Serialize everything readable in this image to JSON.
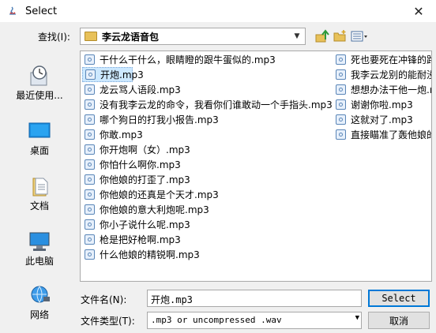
{
  "window": {
    "title": "Select"
  },
  "lookin": {
    "label": "查找(I):",
    "value": "李云龙语音包"
  },
  "places": [
    {
      "label": "最近使用...",
      "icon": "recent-icon"
    },
    {
      "label": "桌面",
      "icon": "desktop-icon"
    },
    {
      "label": "文档",
      "icon": "documents-icon"
    },
    {
      "label": "此电脑",
      "icon": "computer-icon"
    },
    {
      "label": "网络",
      "icon": "network-icon"
    }
  ],
  "files": {
    "col1": [
      "干什么干什么，眼睛瞪的跟牛蛋似的.mp3",
      "开炮.mp3",
      "龙云骂人语段.mp3",
      "没有我李云龙的命令，我看你们谁敢动一个手指头.mp3",
      "哪个狗日的打我小报告.mp3",
      "你敢.mp3",
      "你开炮啊（女）.mp3",
      "你怕什么啊你.mp3",
      "你他娘的打歪了.mp3",
      "你他娘的还真是个天才.mp3",
      "你他娘的意大利炮呢.mp3",
      "你小子说什么呢.mp3",
      "枪是把好枪啊.mp3",
      "什么他娘的精锐啊.mp3"
    ],
    "col2": [
      "死也要死在冲锋的路",
      "我李云龙别的能耐没",
      "想想办法干他一炮.m",
      "谢谢你啦.mp3",
      "这就对了.mp3",
      "直接瞄准了轰他娘的"
    ],
    "selected": "开炮.mp3"
  },
  "filename": {
    "label": "文件名(N):",
    "value": "开炮.mp3"
  },
  "filetype": {
    "label": "文件类型(T):",
    "value": ".mp3 or uncompressed .wav"
  },
  "buttons": {
    "select": "Select",
    "cancel": "取消"
  }
}
